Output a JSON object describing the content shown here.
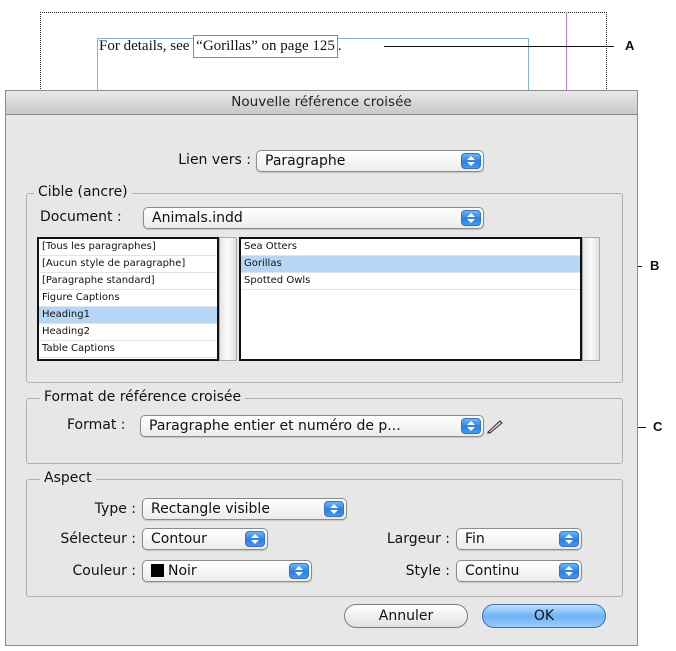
{
  "preview": {
    "sentence_prefix": "For details, see ",
    "xref_text": "“Gorillas” on page 125",
    "sentence_suffix": "."
  },
  "callouts": {
    "a": "A",
    "b": "B",
    "c": "C"
  },
  "dialog": {
    "title": "Nouvelle référence croisée",
    "link_to": {
      "label": "Lien vers :",
      "value": "Paragraphe"
    },
    "target": {
      "group_title": "Cible (ancre)",
      "document_label": "Document :",
      "document_value": "Animals.indd",
      "styles": [
        "[Tous les paragraphes]",
        "[Aucun style de paragraphe]",
        "[Paragraphe standard]",
        "Figure Captions",
        "Heading1",
        "Heading2",
        "Table Captions"
      ],
      "selected_style_index": 4,
      "paragraphs": [
        "Sea Otters",
        "Gorillas",
        "Spotted Owls"
      ],
      "selected_paragraph_index": 1
    },
    "format": {
      "group_title": "Format de référence croisée",
      "label": "Format :",
      "value": "Paragraphe entier et numéro de p..."
    },
    "appearance": {
      "group_title": "Aspect",
      "type_label": "Type :",
      "type_value": "Rectangle visible",
      "highlight_label": "Sélecteur :",
      "highlight_value": "Contour",
      "width_label": "Largeur :",
      "width_value": "Fin",
      "color_label": "Couleur :",
      "color_value": "Noir",
      "style_label": "Style :",
      "style_value": "Continu"
    },
    "buttons": {
      "cancel": "Annuler",
      "ok": "OK"
    }
  },
  "colors": {
    "accent": "#2a7fe0",
    "selection": "#b7d6f6",
    "swatch": "#000000"
  }
}
